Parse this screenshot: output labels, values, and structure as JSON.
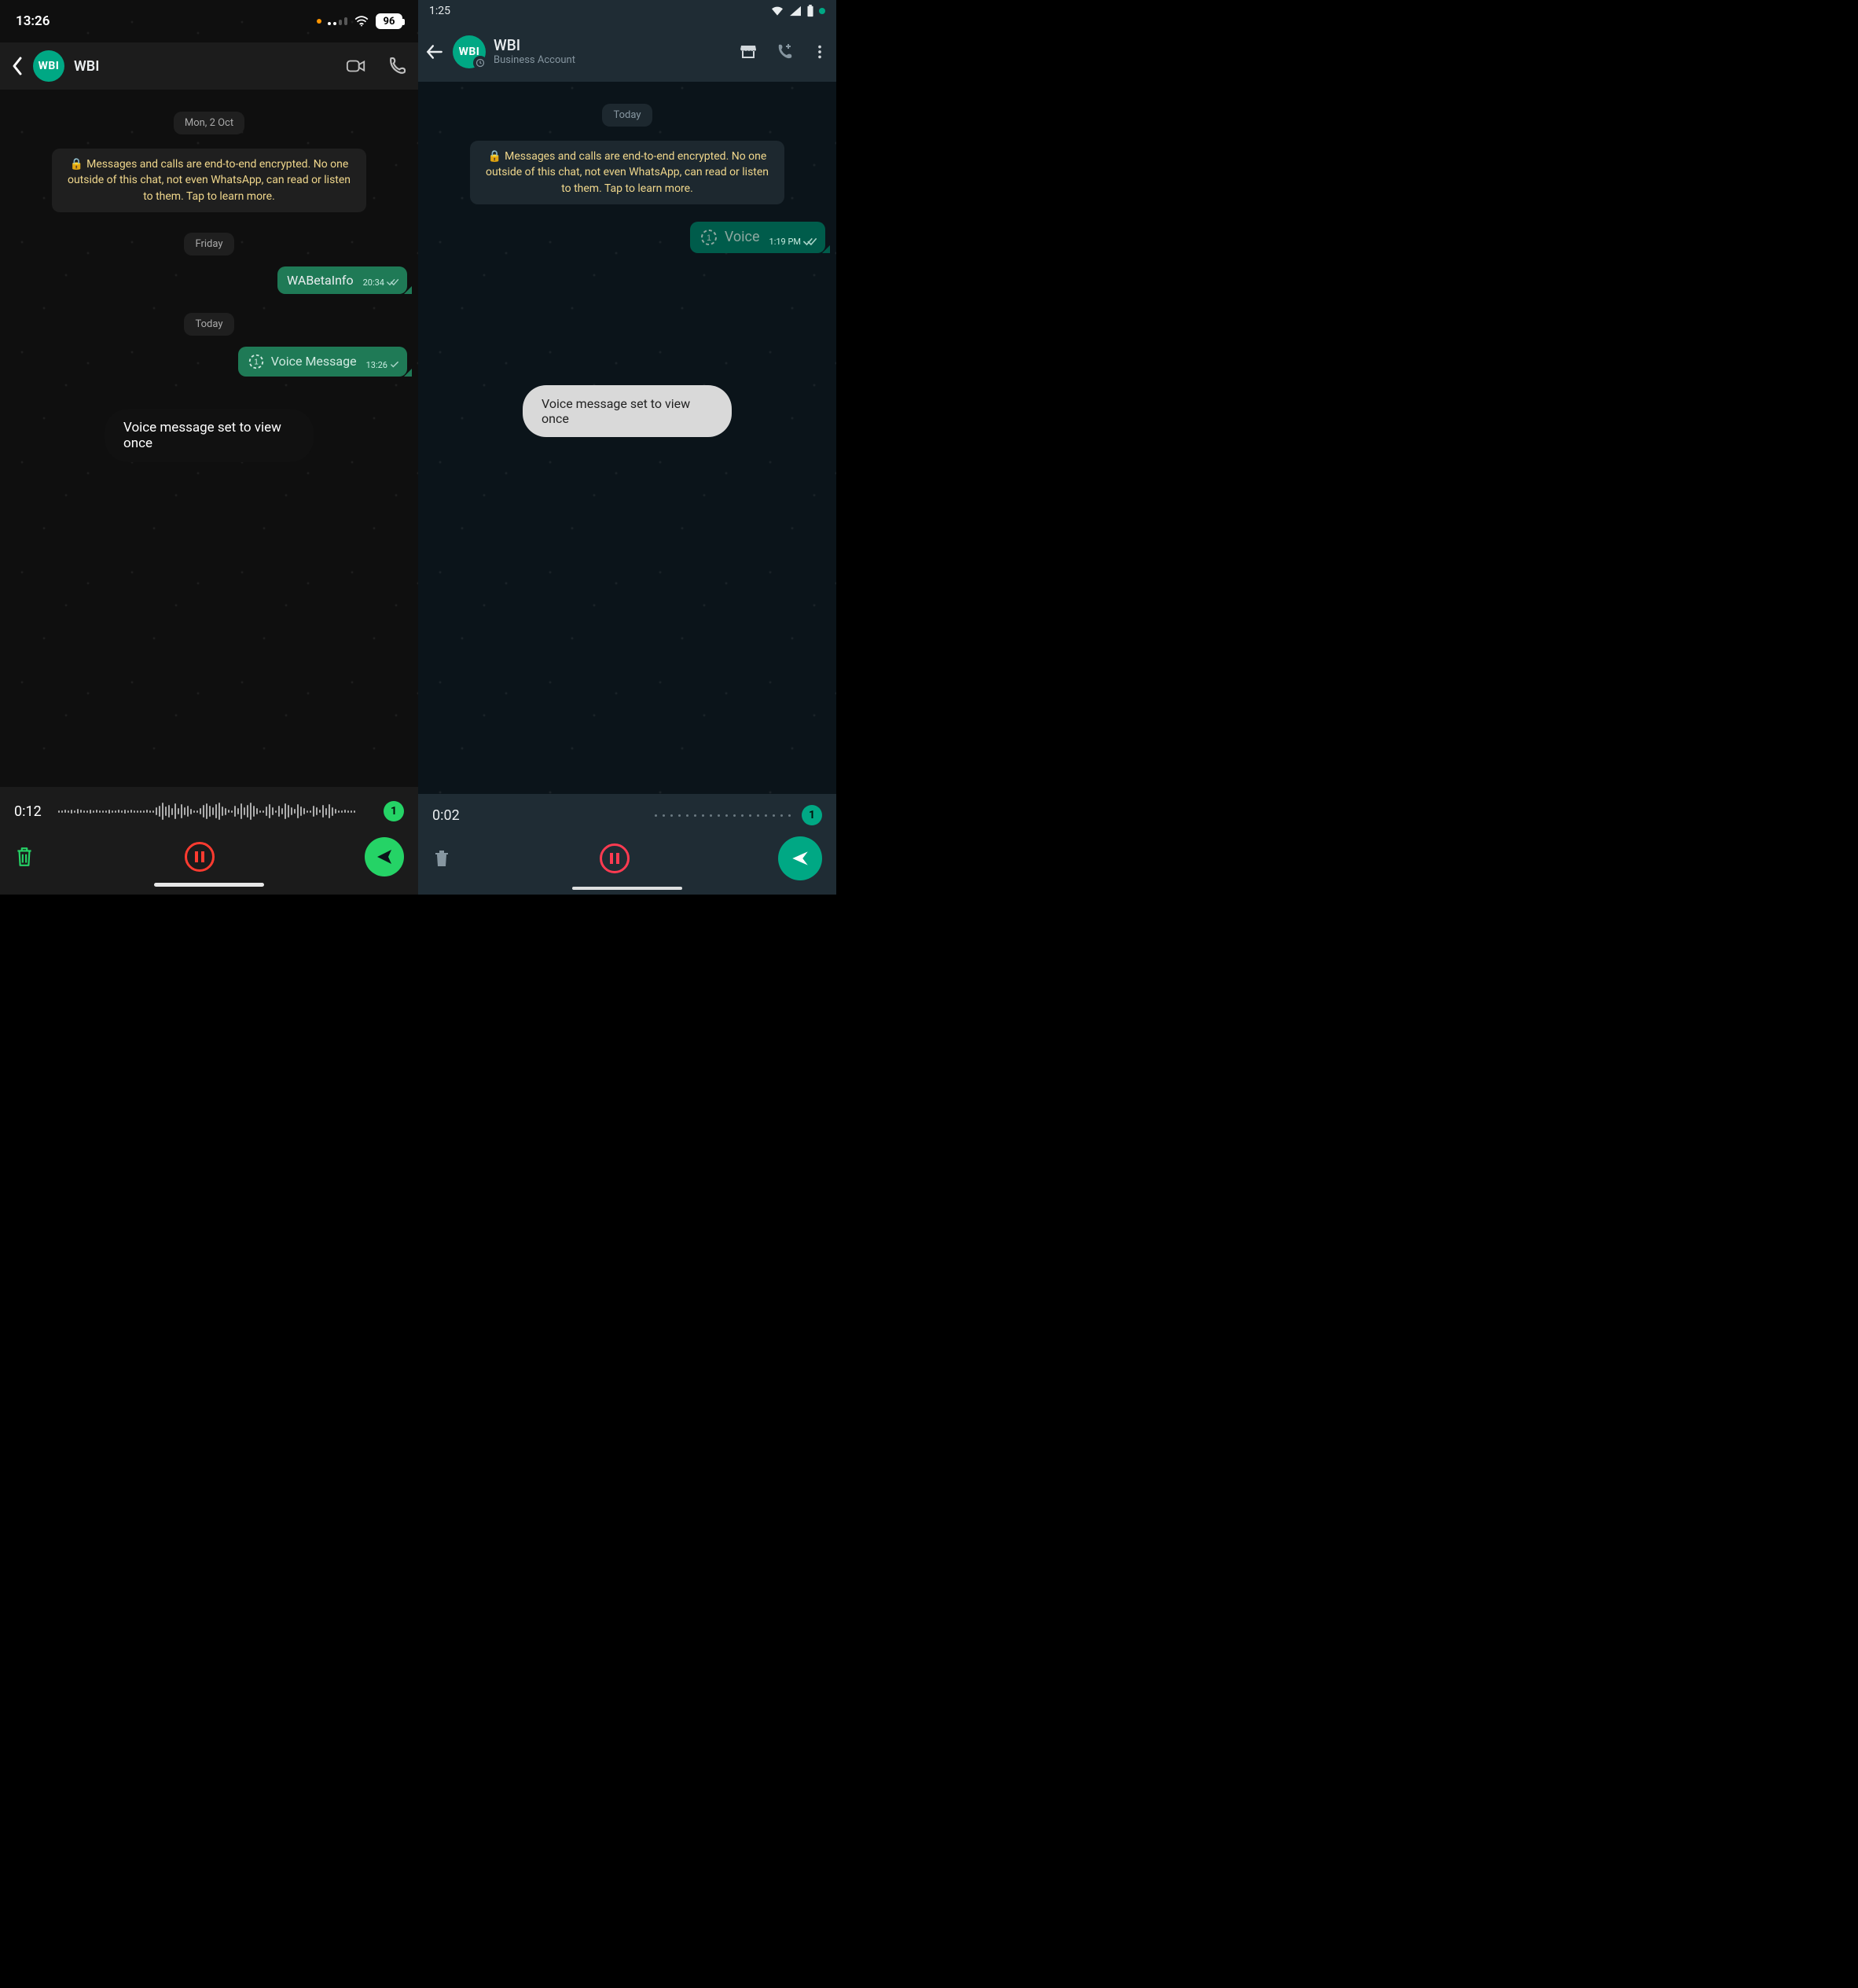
{
  "ios": {
    "status": {
      "time": "13:26",
      "battery": "96"
    },
    "header": {
      "avatar": "WBI",
      "title": "WBI"
    },
    "chips": {
      "mon": "Mon, 2 Oct",
      "fri": "Friday",
      "today": "Today"
    },
    "encryption": "Messages and calls are end-to-end encrypted. No one outside of this chat, not even WhatsApp, can read or listen to them. Tap to learn more.",
    "bubble_text": {
      "text": "WABetaInfo",
      "time": "20:34"
    },
    "bubble_voice": {
      "label": "Voice Message",
      "time": "13:26"
    },
    "toast": "Voice message set to view once",
    "recorder": {
      "time": "0:12",
      "badge": "1"
    }
  },
  "android": {
    "status": {
      "time": "1:25"
    },
    "header": {
      "avatar": "WBI",
      "title": "WBI",
      "subtitle": "Business Account"
    },
    "chips": {
      "today": "Today"
    },
    "encryption": "Messages and calls are end-to-end encrypted. No one outside of this chat, not even WhatsApp, can read or listen to them. Tap to learn more.",
    "bubble_voice": {
      "label": "Voice",
      "time": "1:19 PM"
    },
    "toast": "Voice message set to view once",
    "recorder": {
      "time": "0:02",
      "badge": "1"
    }
  }
}
